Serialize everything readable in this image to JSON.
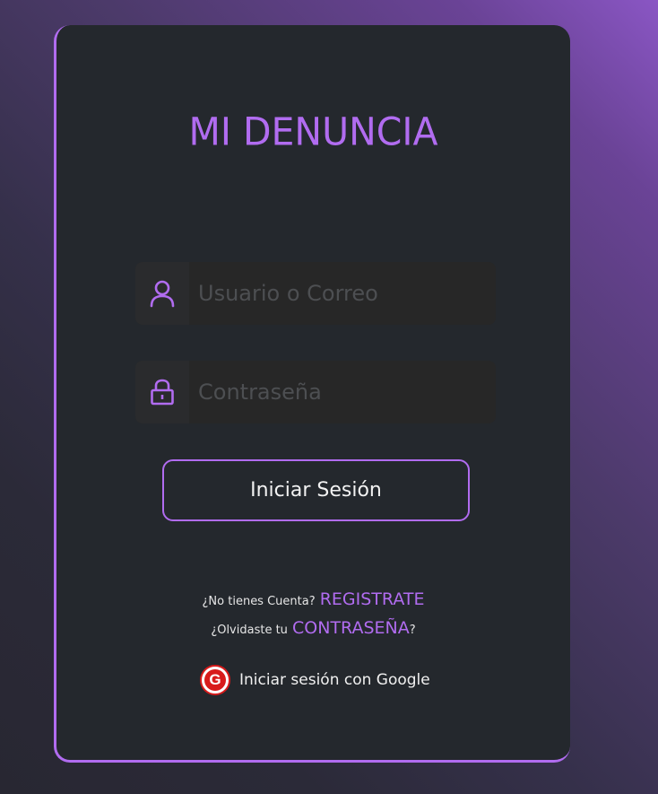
{
  "app": {
    "title": "MI DENUNCIA"
  },
  "form": {
    "user_placeholder": "Usuario o Correo",
    "user_value": "",
    "password_placeholder": "Contraseña",
    "password_value": "",
    "user_icon": "user-icon",
    "password_icon": "lock-icon",
    "submit_label": "Iniciar Sesión"
  },
  "links": {
    "register_prompt": "¿No tienes Cuenta?",
    "register_link": "REGISTRATE",
    "forgot_prompt": "¿Olvidaste tu",
    "forgot_link": "CONTRASEÑA",
    "forgot_suffix": "?",
    "google_icon_letter": "G",
    "google_label": "Iniciar sesión con Google"
  },
  "colors": {
    "accent": "#b16cf0",
    "card_bg": "#24282d",
    "google_red": "#d81b1b"
  }
}
